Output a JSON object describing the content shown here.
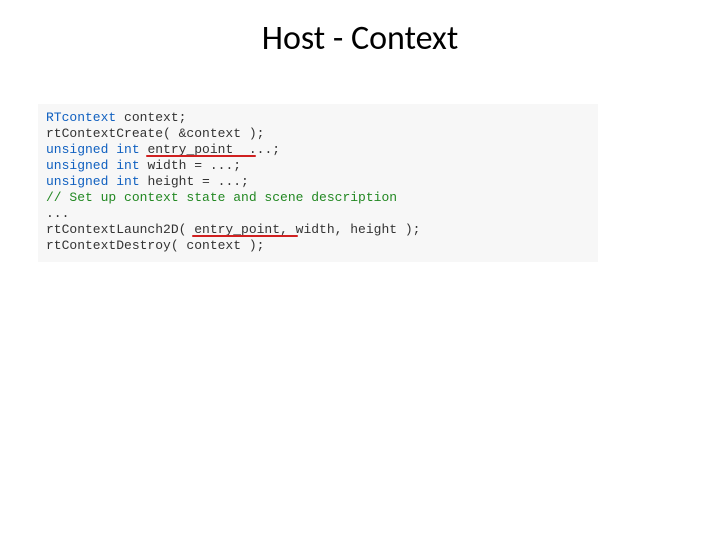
{
  "title": "Host - Context",
  "code": {
    "l1": {
      "a": "RTcontext",
      "b": " context;"
    },
    "l2": {
      "a": "rtContextCreate( &context );"
    },
    "l3": {
      "a": "unsigned",
      "b": " ",
      "c": "int",
      "d": " entry_point  ...;"
    },
    "l4": {
      "a": "unsigned",
      "b": " ",
      "c": "int",
      "d": " width = ...;"
    },
    "l5": {
      "a": "unsigned",
      "b": " ",
      "c": "int",
      "d": " height = ...;"
    },
    "l6": {
      "a": "// Set up context state and scene description"
    },
    "l7": {
      "a": "..."
    },
    "l8": {
      "a": "rtContextLaunch2D( entry_point, width, height );"
    },
    "l9": {
      "a": "rtContextDestroy( context );"
    }
  }
}
